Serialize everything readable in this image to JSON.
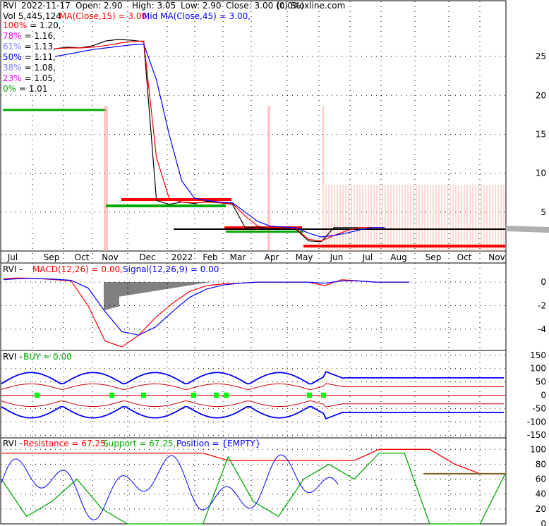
{
  "ticker": "RVI",
  "copyright": "(c) Stoxline.com",
  "header": {
    "date": "2022-11-17",
    "open": "Open: 2.90",
    "high": "High: 3.05",
    "low": "Low: 2.90",
    "close": "Close: 3.00 (0.0%)",
    "volume": "Vol 5,445,124",
    "ma15": "MA(Close,15) = 3.00,",
    "ma45": "Mid MA(Close,45) = 3.00,"
  },
  "fib_levels": [
    {
      "label": "100% = 1.20,",
      "color": "#ff0000"
    },
    {
      "label": "78% = 1.16,",
      "color": "#ff00ff"
    },
    {
      "label": "61% = 1.13,",
      "color": "#8080ff"
    },
    {
      "label": "50% = 1.11,",
      "color": "#0000ff"
    },
    {
      "label": "38% = 1.08,",
      "color": "#8080ff"
    },
    {
      "label": "23% = 1.05,",
      "color": "#ff00ff"
    },
    {
      "label": "0% = 1.01",
      "color": "#00aa00"
    }
  ],
  "months": [
    "Jul",
    "Sep",
    "Oct",
    "Nov",
    "Dec",
    "2022",
    "Feb",
    "Mar",
    "Apr",
    "May",
    "Jun",
    "Jul",
    "Aug",
    "Sep",
    "Oct",
    "Nov"
  ],
  "macd_panel": {
    "prefix": "RVI -",
    "macd_label": "MACD(12,26) = 0.00,",
    "signal_label": "Signal(12,26,9) = 0.00",
    "y_ticks": [
      "0",
      "-2",
      "-4"
    ]
  },
  "buy_panel": {
    "prefix": "RVI -",
    "buy_label": "BUY = 0.00",
    "y_ticks": [
      "150",
      "100",
      "50",
      "0",
      "-50",
      "-100",
      "-150"
    ]
  },
  "sr_panel": {
    "prefix": "RVI -",
    "resistance_label": "Resistance = 67.25,",
    "support_label": "Support = 67.25,",
    "position_label": "Position = {EMPTY}",
    "y_ticks": [
      "100",
      "80",
      "60",
      "40",
      "20",
      "0"
    ]
  },
  "chart_data": [
    {
      "type": "line",
      "panel": "price",
      "y_ticks": [
        "25",
        "20",
        "15",
        "10",
        "5"
      ],
      "ylim": [
        0,
        29
      ],
      "x_months": [
        "Jul",
        "Sep",
        "Oct",
        "Nov",
        "Dec",
        "2022",
        "Feb",
        "Mar",
        "Apr",
        "May",
        "Jun",
        "Jul",
        "Aug",
        "Sep",
        "Oct",
        "Nov"
      ],
      "series": [
        {
          "name": "Close",
          "color": "#000000",
          "values": [
            26.0,
            26.2,
            26.1,
            26.4,
            27.0,
            27.2,
            27.1,
            26.9,
            6.5,
            6.0,
            6.3,
            6.1,
            6.4,
            6.2,
            6.0,
            3.0,
            3.1,
            2.9,
            3.0,
            2.8,
            1.3,
            1.2,
            3.0,
            3.0,
            3.0,
            3.0,
            3.0
          ]
        },
        {
          "name": "MA(Close,15)",
          "color": "#ff0000",
          "values": [
            26.0,
            26.1,
            26.1,
            26.2,
            26.4,
            26.7,
            26.9,
            27.0,
            12.0,
            6.8,
            6.3,
            6.2,
            6.3,
            6.2,
            6.1,
            4.5,
            3.2,
            3.0,
            3.0,
            2.9,
            1.5,
            1.3,
            2.0,
            2.6,
            3.0,
            3.0,
            3.0
          ]
        },
        {
          "name": "MA(Close,45)",
          "color": "#0000ff",
          "values": [
            25.0,
            25.3,
            25.6,
            25.9,
            26.1,
            26.3,
            26.5,
            26.6,
            22.0,
            15.0,
            9.0,
            6.8,
            6.5,
            6.3,
            6.2,
            5.0,
            3.8,
            3.2,
            3.1,
            3.0,
            2.3,
            1.8,
            2.0,
            2.3,
            2.7,
            3.0,
            3.0
          ]
        }
      ],
      "volume_note": "Vol 5,445,124"
    },
    {
      "type": "line",
      "panel": "macd",
      "y_ticks": [
        "0",
        "-2",
        "-4"
      ],
      "ylim": [
        -5.8,
        1.2
      ],
      "series": [
        {
          "name": "MACD(12,26)",
          "color": "#ff0000",
          "values": [
            0.3,
            0.35,
            0.3,
            0.2,
            0.1,
            -2.0,
            -5.0,
            -5.5,
            -4.5,
            -3.0,
            -1.8,
            -0.8,
            -0.3,
            -0.15,
            -0.1,
            0.0,
            0.0,
            0.0,
            0.0,
            -0.3,
            0.2,
            0.1,
            0.0,
            0.0,
            0.0
          ]
        },
        {
          "name": "Signal(12,26,9)",
          "color": "#0000ff",
          "values": [
            0.2,
            0.3,
            0.3,
            0.25,
            0.15,
            -0.5,
            -2.5,
            -4.2,
            -4.5,
            -3.8,
            -2.5,
            -1.3,
            -0.6,
            -0.25,
            -0.1,
            0.0,
            0.0,
            0.0,
            0.0,
            -0.1,
            0.1,
            0.1,
            0.0,
            0.0,
            0.0
          ]
        }
      ]
    },
    {
      "type": "line",
      "panel": "buy",
      "y_ticks": [
        "150",
        "100",
        "50",
        "0",
        "-50",
        "-100",
        "-150"
      ],
      "ylim": [
        -160,
        160
      ],
      "series": [
        {
          "name": "BUY",
          "color": "#00ff00",
          "values": [
            0,
            0,
            0,
            0,
            0
          ]
        }
      ]
    },
    {
      "type": "line",
      "panel": "sr",
      "y_ticks": [
        "100",
        "80",
        "60",
        "40",
        "20",
        "0"
      ],
      "ylim": [
        0,
        105
      ],
      "series": [
        {
          "name": "Resistance",
          "color": "#ff0000",
          "values": [
            95,
            95,
            95,
            95,
            95,
            95,
            95,
            95,
            95,
            85,
            85,
            85,
            85,
            85,
            85,
            100,
            100,
            100,
            80,
            67.25,
            67.25
          ]
        },
        {
          "name": "Support",
          "color": "#00aa00",
          "values": [
            60,
            10,
            30,
            60,
            20,
            0,
            0,
            0,
            0,
            90,
            30,
            10,
            60,
            80,
            60,
            95,
            95,
            0,
            0,
            0,
            67.25
          ]
        }
      ]
    }
  ]
}
